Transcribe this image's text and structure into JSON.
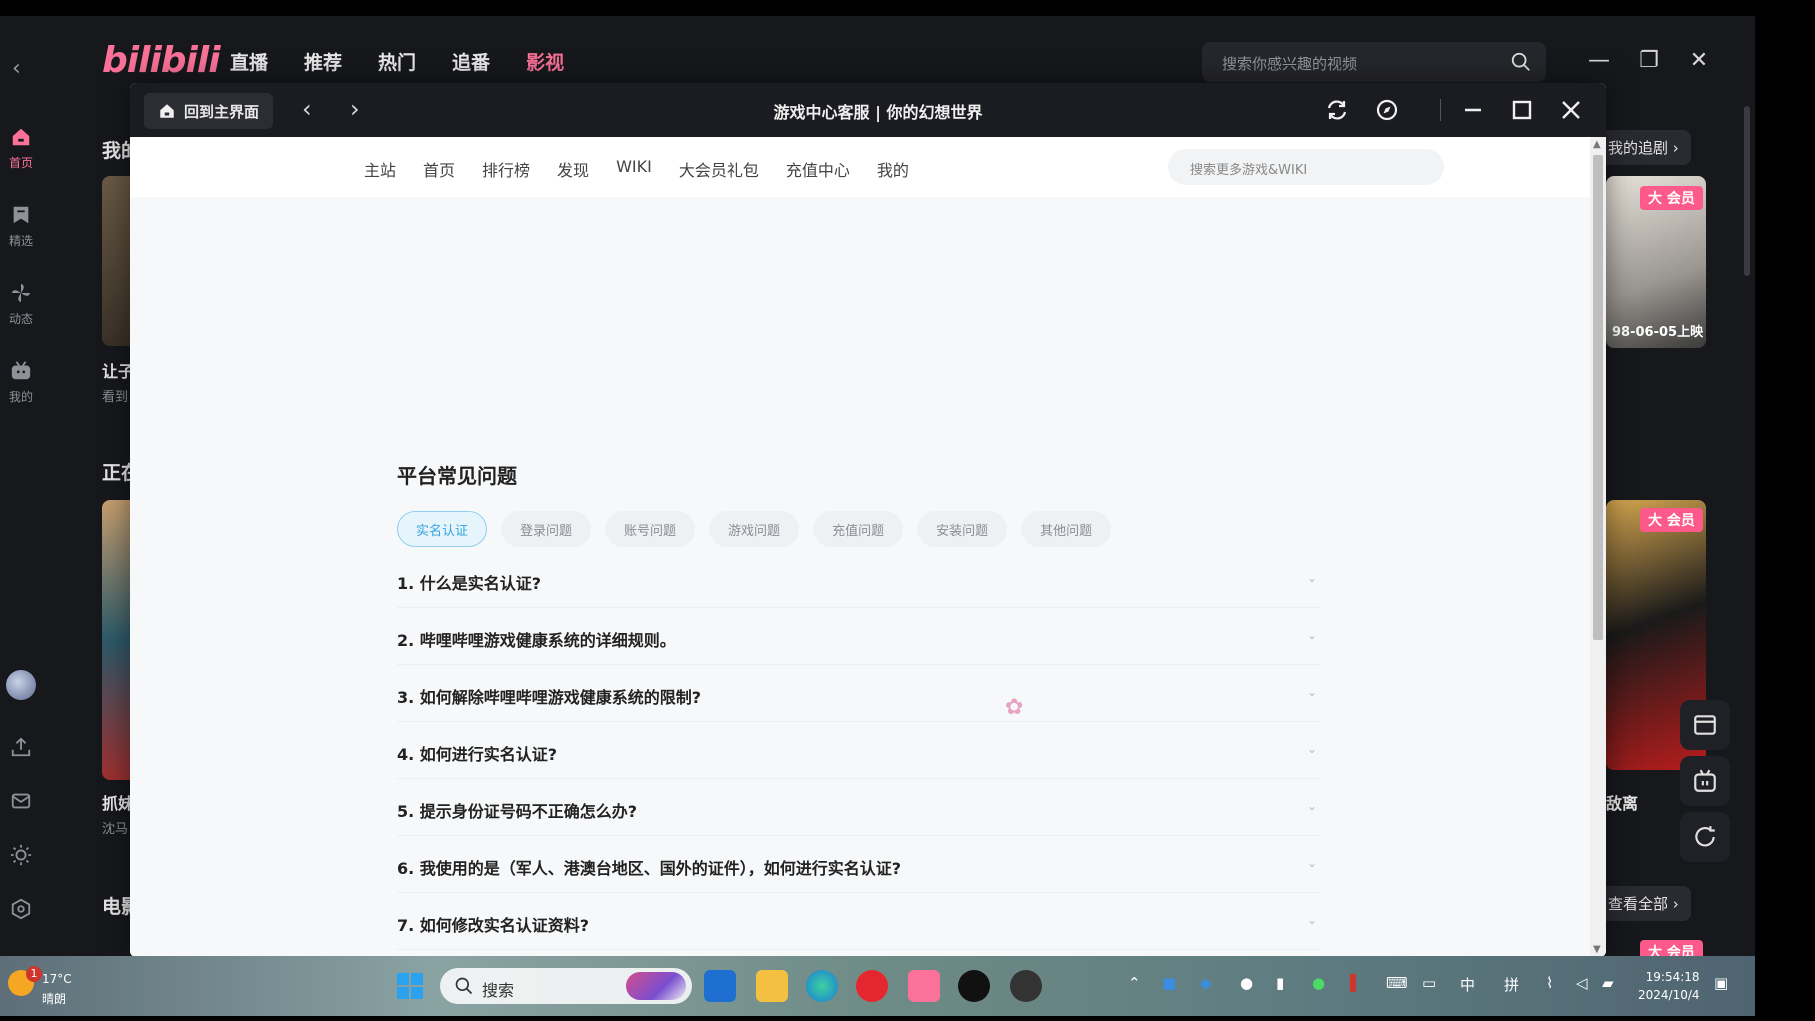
{
  "bili": {
    "logo": "bilibili",
    "tabs": [
      "直播",
      "推荐",
      "热门",
      "追番",
      "影视"
    ],
    "active_tab": "影视",
    "search_placeholder": "搜索你感兴趣的视频",
    "nav": [
      {
        "label": "首页",
        "icon": "home-icon"
      },
      {
        "label": "精选",
        "icon": "bookmark-icon"
      },
      {
        "label": "动态",
        "icon": "pinwheel-icon"
      },
      {
        "label": "我的",
        "icon": "tv-icon"
      }
    ],
    "headings": {
      "h1": "我的",
      "h2": "正在",
      "h3": "电影"
    },
    "card_texts": {
      "t1": "让子",
      "t1_sub": "看到",
      "t2": "抓妹",
      "t2_sub": "沈马"
    },
    "right_pills": {
      "my_follow": "我的追剧",
      "see_all": "查看全部"
    },
    "right_card_text": {
      "date": "98-06-05上映",
      "title": "敌离"
    },
    "vip_label": "会员",
    "vip_char": "大"
  },
  "popup": {
    "home_button": "回到主界面",
    "title": "游戏中心客服 | 你的幻想世界",
    "nav_links": [
      "主站",
      "首页",
      "排行榜",
      "发现",
      "WIKI",
      "大会员礼包",
      "充值中心",
      "我的"
    ],
    "search_placeholder": "搜索更多游戏&WIKI",
    "faq_title": "平台常见问题",
    "tabs": [
      "实名认证",
      "登录问题",
      "账号问题",
      "游戏问题",
      "充值问题",
      "安装问题",
      "其他问题"
    ],
    "active_tab": "实名认证",
    "faq": [
      "1.  什么是实名认证?",
      "2.  哔哩哔哩游戏健康系统的详细规则。",
      "3.  如何解除哔哩哔哩游戏健康系统的限制?",
      "4.  如何进行实名认证?",
      "5.  提示身份证号码不正确怎么办?",
      "6.  我使用的是（军人、港澳台地区、国外的证件），如何进行实名认证?",
      "7.  如何修改实名认证资料?"
    ]
  },
  "taskbar": {
    "weather_temp": "17°C",
    "weather_desc": "晴朗",
    "weather_badge": "1",
    "search": "搜索",
    "ime1": "中",
    "ime2": "拼",
    "time": "19:54:18",
    "date": "2024/10/4"
  },
  "colors": {
    "accent": "#fb7299",
    "tab_active": "#37a4e0"
  }
}
